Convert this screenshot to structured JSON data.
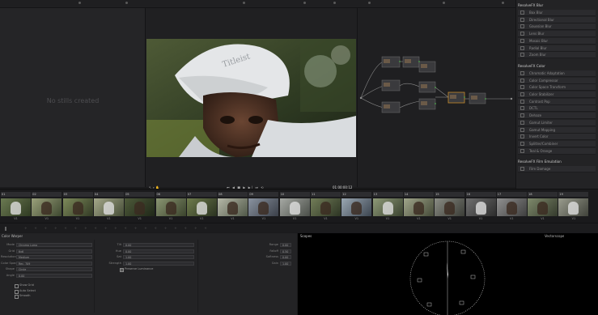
{
  "gallery": {
    "empty_text": "No stills created"
  },
  "viewer": {
    "timecode": "01:00:00:12",
    "toolbar_icons": [
      "pointer-icon",
      "zoom-icon",
      "hand-icon"
    ],
    "transport_icons": [
      "skip-start-icon",
      "step-back-icon",
      "stop-icon",
      "play-icon",
      "step-forward-icon",
      "skip-end-icon",
      "loop-icon"
    ]
  },
  "effects": {
    "section1": "ResolveFX Blur",
    "section1_items": [
      "Box Blur",
      "Directional Blur",
      "Gaussian Blur",
      "Lens Blur",
      "Mosaic Blur",
      "Radial Blur",
      "Zoom Blur"
    ],
    "section2": "ResolveFX Color",
    "section2_items": [
      "Chromatic Adaptation",
      "Color Compressor",
      "Color Space Transform",
      "Color Stabilizer",
      "Contrast Pop",
      "DCTL",
      "Dehaze",
      "Gamut Limiter",
      "Gamut Mapping",
      "Invert Color",
      "Splitter/Combiner",
      "Teal & Orange"
    ],
    "section3": "ResolveFX Film Emulation",
    "section3_items": [
      "Film Damage"
    ]
  },
  "clips": {
    "items": [
      {
        "num": "01",
        "tc": "00:00:00:00",
        "label": "V1"
      },
      {
        "num": "02",
        "tc": "00:00:00:00",
        "label": "V1"
      },
      {
        "num": "03",
        "tc": "00:00:00:00",
        "label": "V1"
      },
      {
        "num": "04",
        "tc": "00:00:00:00",
        "label": "V1"
      },
      {
        "num": "05",
        "tc": "00:00:00:00",
        "label": "V1"
      },
      {
        "num": "06",
        "tc": "00:00:00:00",
        "label": "V1"
      },
      {
        "num": "07",
        "tc": "00:00:00:00",
        "label": "V1"
      },
      {
        "num": "08",
        "tc": "00:00:00:00",
        "label": "V1"
      },
      {
        "num": "09",
        "tc": "00:00:00:00",
        "label": "V1"
      },
      {
        "num": "10",
        "tc": "00:00:00:00",
        "label": "V1"
      },
      {
        "num": "11",
        "tc": "00:00:00:00",
        "label": "V1"
      },
      {
        "num": "12",
        "tc": "00:00:00:00",
        "label": "V1"
      },
      {
        "num": "13",
        "tc": "00:00:00:00",
        "label": "V1"
      },
      {
        "num": "14",
        "tc": "00:00:00:00",
        "label": "V1"
      },
      {
        "num": "15",
        "tc": "00:00:00:00",
        "label": "V1"
      },
      {
        "num": "16",
        "tc": "00:00:00:00",
        "label": "V1"
      },
      {
        "num": "17",
        "tc": "00:00:00:00",
        "label": "V1"
      },
      {
        "num": "18",
        "tc": "00:00:00:00",
        "label": "V1"
      },
      {
        "num": "19",
        "tc": "00:00:00:00",
        "label": "V1"
      }
    ]
  },
  "settings": {
    "title": "Color Warper",
    "fields_left": [
      {
        "label": "Mode",
        "value": "Chroma Luma"
      },
      {
        "label": "Grid",
        "value": "6x6"
      },
      {
        "label": "Resolution",
        "value": "Medium"
      },
      {
        "label": "Color Space",
        "value": "Rec. 709"
      },
      {
        "label": "Shape",
        "value": "Circle"
      },
      {
        "label": "Angle",
        "value": "0.00"
      }
    ],
    "checks": [
      "Show Grid",
      "Auto Select",
      "Smooth"
    ],
    "fields_mid": [
      {
        "label": "Tilt",
        "value": "0.00"
      },
      {
        "label": "Hue",
        "value": "0.00"
      },
      {
        "label": "Sat",
        "value": "1.00"
      },
      {
        "label": "Strength",
        "value": "1.00"
      }
    ],
    "mid_check": "Preserve Luminance",
    "fields_right": [
      {
        "label": "Range",
        "value": "0.00"
      },
      {
        "label": "Falloff",
        "value": "0.50"
      },
      {
        "label": "Softness",
        "value": "0.00"
      },
      {
        "label": "Gain",
        "value": "1.00"
      }
    ]
  },
  "scopes": {
    "title": "Scopes",
    "mode": "Vectorscope"
  },
  "colors": {
    "accent": "#d9a94a",
    "node_selected": "#c88b2a",
    "panel": "#232325"
  }
}
